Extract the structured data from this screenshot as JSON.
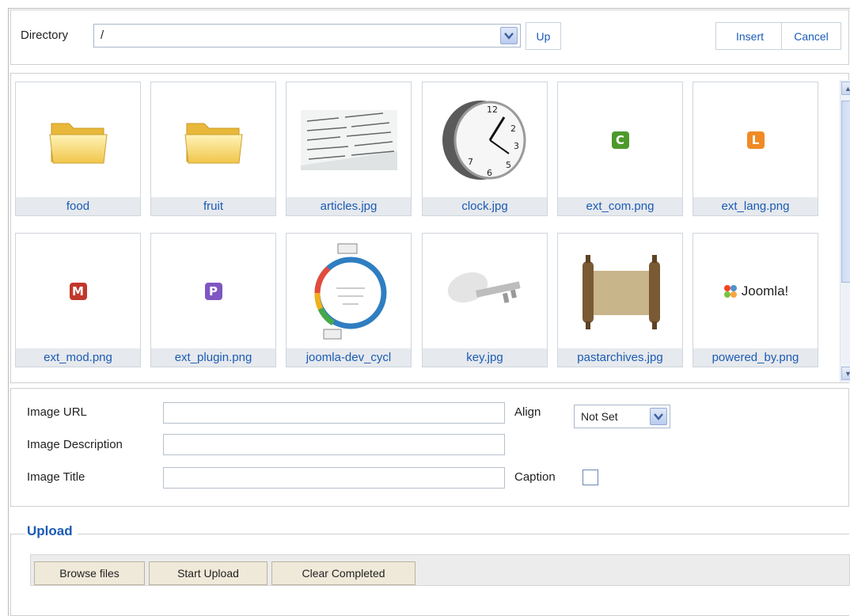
{
  "toolbar": {
    "directory_label": "Directory",
    "directory_value": "/",
    "up_label": "Up",
    "insert_label": "Insert",
    "cancel_label": "Cancel"
  },
  "items": [
    {
      "caption": "food",
      "kind": "folder"
    },
    {
      "caption": "fruit",
      "kind": "folder"
    },
    {
      "caption": "articles.jpg",
      "kind": "photo-articles"
    },
    {
      "caption": "clock.jpg",
      "kind": "photo-clock"
    },
    {
      "caption": "ext_com.png",
      "kind": "badge",
      "letter": "C",
      "color": "#4c9a2a"
    },
    {
      "caption": "ext_lang.png",
      "kind": "badge",
      "letter": "L",
      "color": "#f08a24"
    },
    {
      "caption": "ext_mod.png",
      "kind": "badge",
      "letter": "M",
      "color": "#c2372b"
    },
    {
      "caption": "ext_plugin.png",
      "kind": "badge",
      "letter": "P",
      "color": "#7e57c2"
    },
    {
      "caption": "joomla-dev_cycl",
      "kind": "photo-cycle"
    },
    {
      "caption": "key.jpg",
      "kind": "photo-key"
    },
    {
      "caption": "pastarchives.jpg",
      "kind": "photo-scroll"
    },
    {
      "caption": "powered_by.png",
      "kind": "joomla-logo",
      "logo_text": "Joomla!"
    }
  ],
  "form": {
    "image_url_label": "Image URL",
    "image_url_value": "",
    "image_description_label": "Image Description",
    "image_description_value": "",
    "image_title_label": "Image Title",
    "image_title_value": "",
    "align_label": "Align",
    "align_value": "Not Set",
    "caption_label": "Caption"
  },
  "upload": {
    "legend": "Upload",
    "browse_label": "Browse files",
    "start_label": "Start Upload",
    "clear_label": "Clear Completed"
  },
  "colors": {
    "link_blue": "#1b5bb5",
    "caption_bg": "#e6e9ed"
  }
}
